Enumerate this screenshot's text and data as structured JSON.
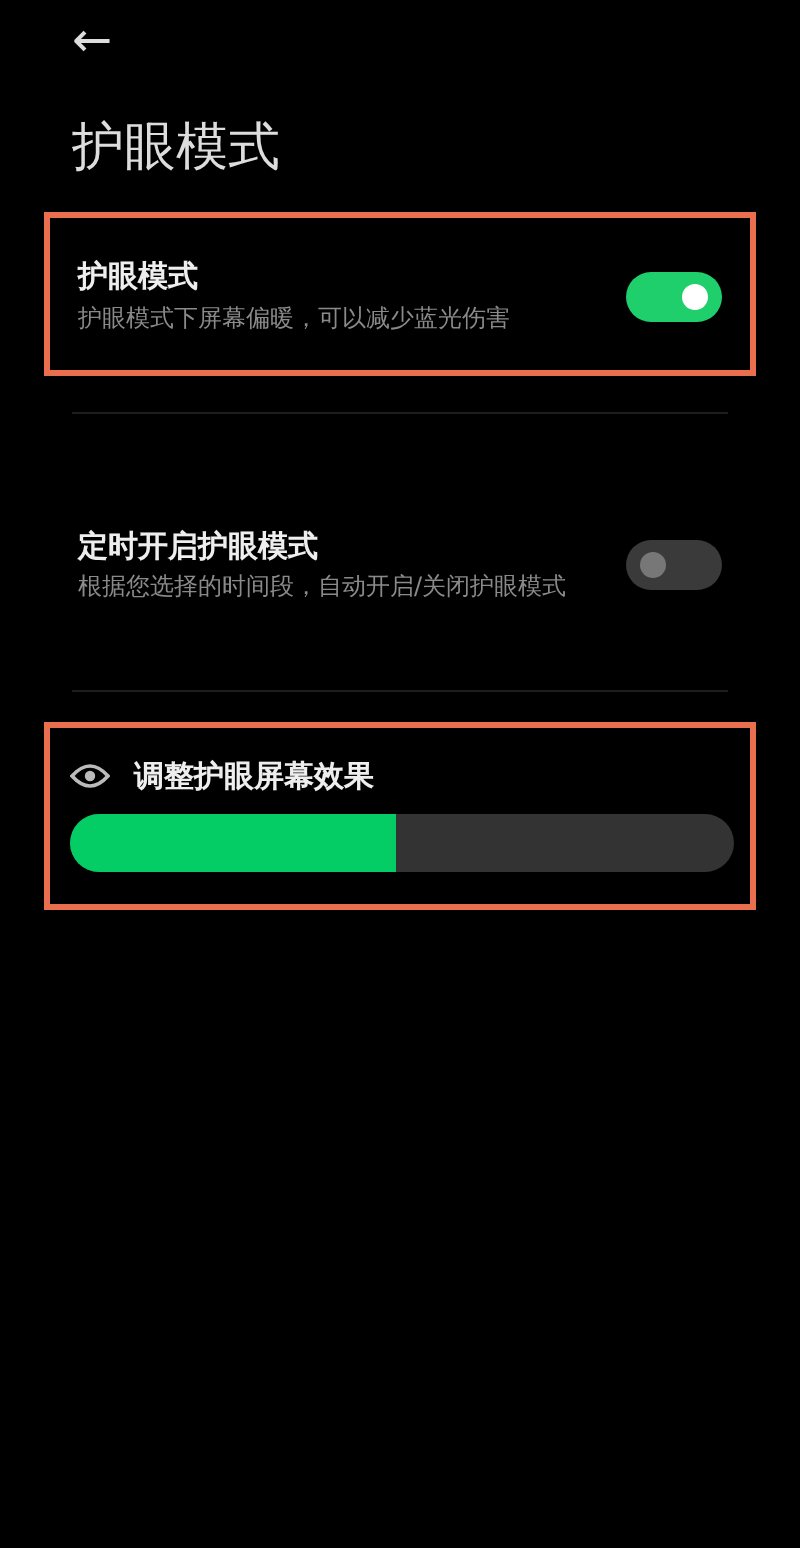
{
  "header": {
    "back": "←",
    "title": "护眼模式"
  },
  "settings": [
    {
      "kind": "toggle",
      "title": "护眼模式",
      "description": "护眼模式下屏幕偏暖，可以减少蓝光伤害",
      "on": true,
      "highlighted": true
    },
    {
      "kind": "toggle",
      "title": "定时开启护眼模式",
      "description": "根据您选择的时间段，自动开启/关闭护眼模式",
      "on": false,
      "highlighted": false
    },
    {
      "kind": "slider",
      "title": "调整护眼屏幕效果",
      "level": 0.49,
      "highlighted": true
    }
  ]
}
